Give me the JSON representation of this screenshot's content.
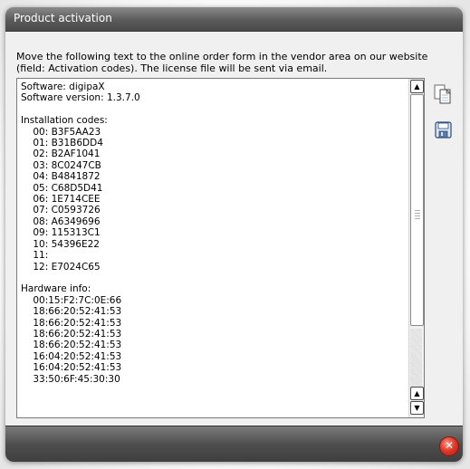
{
  "window": {
    "title": "Product activation"
  },
  "instructions": "Move the following text to the online order form in the vendor area on our website (field: Activation codes). The license file will be sent via email.",
  "textbox": {
    "lines": [
      "Software: digipaX",
      "Software version: 1.3.7.0",
      "",
      "Installation codes:",
      "    00: B3F5AA23",
      "    01: B31B6DD4",
      "    02: B2AF1041",
      "    03: 8C0247CB",
      "    04: B4841872",
      "    05: C68D5D41",
      "    06: 1E714CEE",
      "    07: C0593726",
      "    08: A6349696",
      "    09: 115313C1",
      "    10: 54396E22",
      "    11:",
      "    12: E7024C65",
      "",
      "Hardware info:",
      "    00:15:F2:7C:0E:66",
      "    18:66:20:52:41:53",
      "    18:66:20:52:41:53",
      "    18:66:20:52:41:53",
      "    18:66:20:52:41:53",
      "    16:04:20:52:41:53",
      "    16:04:20:52:41:53",
      "    33:50:6F:45:30:30"
    ]
  },
  "side_icons": [
    "copy-icon",
    "save-icon"
  ],
  "bottom": {
    "close_icon": "close-icon",
    "close_glyph": "✕"
  }
}
